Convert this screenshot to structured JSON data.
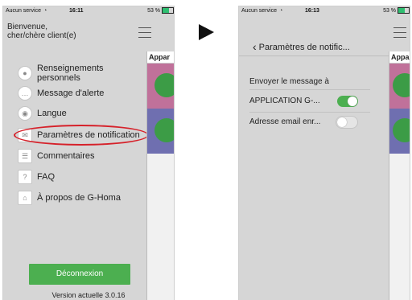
{
  "left_screen": {
    "status": {
      "carrier": "Aucun service",
      "time": "16:11",
      "battery": "53 %"
    },
    "greeting": "Bienvenue,\ncher/chère client(e)",
    "menu": [
      {
        "label": "Renseignements personnels",
        "icon": "person-icon"
      },
      {
        "label": "Message d'alerte",
        "icon": "speech-bubble-icon"
      },
      {
        "label": "Langue",
        "icon": "globe-icon"
      },
      {
        "label": "Paramètres de notification",
        "icon": "envelope-icon"
      },
      {
        "label": "Commentaires",
        "icon": "comment-icon"
      },
      {
        "label": "FAQ",
        "icon": "question-icon"
      },
      {
        "label": "À propos de G-Homa",
        "icon": "house-icon"
      }
    ],
    "side_header": "Appar",
    "logout_label": "Déconnexion",
    "version": "Version actuelle 3.0.16"
  },
  "right_screen": {
    "status": {
      "carrier": "Aucun service",
      "time": "16:13",
      "battery": "53 %"
    },
    "title": "Paramètres de notific...",
    "section_label": "Envoyer le message à",
    "options": [
      {
        "label": "APPLICATION G-...",
        "enabled": true
      },
      {
        "label": "Adresse email enr...",
        "enabled": false
      }
    ],
    "side_header": "Appa"
  },
  "colors": {
    "accent_green": "#4caf50",
    "highlight_red": "#d6212a",
    "band_pink": "#c0719a",
    "band_purple": "#6f6fb0"
  }
}
